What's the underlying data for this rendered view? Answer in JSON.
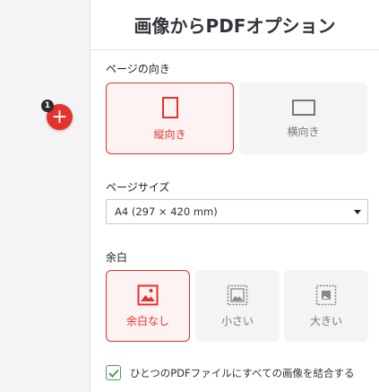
{
  "sidebar": {
    "file_count_badge": "1",
    "add_button_icon": "plus-icon"
  },
  "header": {
    "title": "画像からPDFオプション"
  },
  "orientation": {
    "label": "ページの向き",
    "options": [
      {
        "label": "縦向き",
        "icon": "portrait-page-icon",
        "selected": true
      },
      {
        "label": "横向き",
        "icon": "landscape-page-icon",
        "selected": false
      }
    ]
  },
  "page_size": {
    "label": "ページサイズ",
    "selected_value": "A4 (297 × 420 mm)"
  },
  "margin": {
    "label": "余白",
    "options": [
      {
        "label": "余白なし",
        "icon": "no-margin-image-icon",
        "selected": true
      },
      {
        "label": "小さい",
        "icon": "small-margin-image-icon",
        "selected": false
      },
      {
        "label": "大きい",
        "icon": "big-margin-image-icon",
        "selected": false
      }
    ]
  },
  "merge_option": {
    "label": "ひとつのPDFファイルにすべての画像を結合する",
    "checked": true
  },
  "colors": {
    "accent": "#e5322d",
    "checkbox_green": "#4a9d5a",
    "option_background": "#f4f4f6"
  }
}
